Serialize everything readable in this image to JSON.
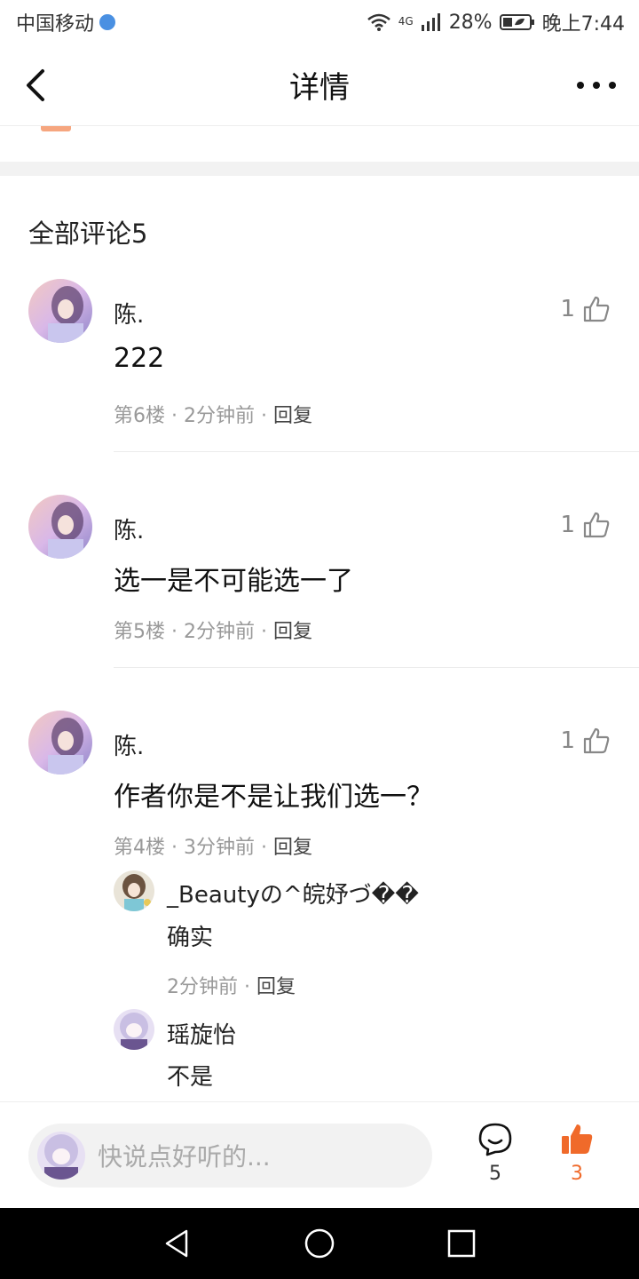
{
  "status_bar": {
    "carrier": "中国移动",
    "network": "4G",
    "battery": "28%",
    "time": "晚上7:44"
  },
  "header": {
    "title": "详情"
  },
  "comments_section": {
    "title": "全部评论5"
  },
  "comments": [
    {
      "username": "陈.",
      "content": "222",
      "floor": "第6楼",
      "time": "2分钟前",
      "reply_label": "回复",
      "likes": "1"
    },
    {
      "username": "陈.",
      "content": "选一是不可能选一了",
      "floor": "第5楼",
      "time": "2分钟前",
      "reply_label": "回复",
      "likes": "1"
    },
    {
      "username": "陈.",
      "content": "作者你是不是让我们选一？",
      "floor": "第4楼",
      "time": "3分钟前",
      "reply_label": "回复",
      "likes": "1",
      "replies": [
        {
          "username": "_Beautyの^皖妤づ��",
          "content": "确实",
          "time": "2分钟前",
          "reply_label": "回复"
        },
        {
          "username": "瑶旋怡",
          "content": "不是"
        }
      ]
    }
  ],
  "bottom_bar": {
    "input_placeholder": "快说点好听的...",
    "comment_count": "5",
    "like_count": "3"
  },
  "colors": {
    "accent": "#f06a2a",
    "divider": "#ececec",
    "muted_text": "#999999"
  }
}
